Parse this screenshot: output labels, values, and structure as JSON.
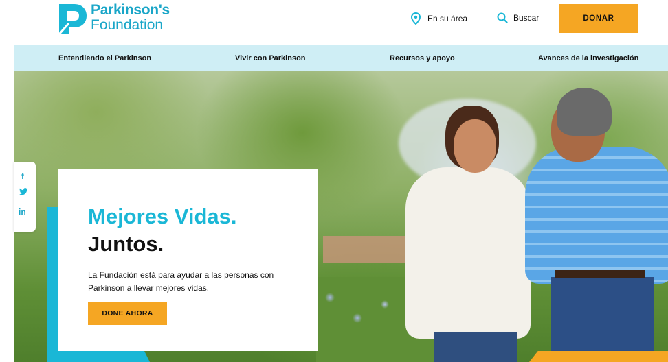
{
  "header": {
    "logo": {
      "line1": "Parkinson's",
      "line2": "Foundation"
    },
    "area_label": "En su área",
    "search_label": "Buscar",
    "donate_label": "DONAR"
  },
  "nav": {
    "items": [
      {
        "label": "Entendiendo el Parkinson"
      },
      {
        "label": "Vivir con Parkinson"
      },
      {
        "label": "Recursos y apoyo"
      },
      {
        "label": "Avances de la investigación"
      }
    ]
  },
  "social": {
    "icons": [
      {
        "name": "facebook-icon",
        "glyph": "f"
      },
      {
        "name": "twitter-icon",
        "glyph": "🐦"
      },
      {
        "name": "linkedin-icon",
        "glyph": "in"
      }
    ]
  },
  "hero": {
    "headline_1": "Mejores Vidas.",
    "headline_2": "Juntos.",
    "description": "La Fundación está para ayudar a las personas con Parkinson a llevar mejores vidas.",
    "cta_label": "DONE AHORA"
  },
  "colors": {
    "brand_teal": "#1ab7d6",
    "accent_orange": "#f5a623",
    "nav_bg": "#cfeef5"
  }
}
